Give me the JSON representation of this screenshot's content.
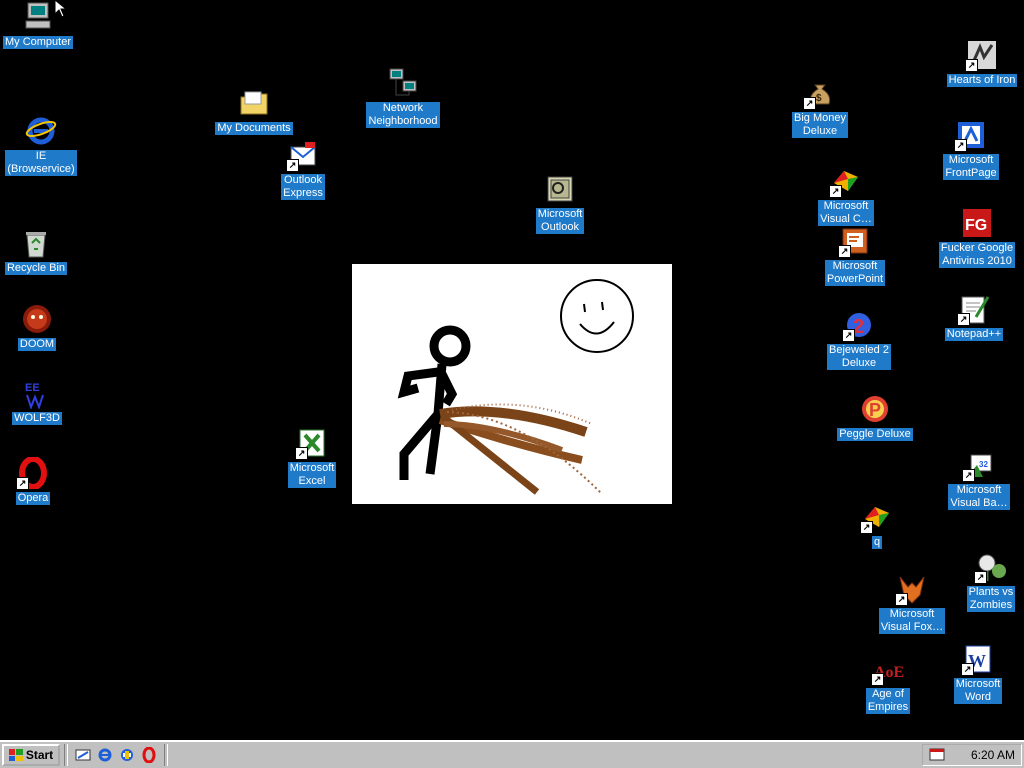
{
  "desktop": {
    "icons": {
      "my_computer": "My Computer",
      "ie": "IE\n(Browservice)",
      "recycle_bin": "Recycle Bin",
      "doom": "DOOM",
      "wolf3d": "WOLF3D",
      "opera": "Opera",
      "my_documents": "My Documents",
      "outlook_express": "Outlook\nExpress",
      "network_neighborhood": "Network\nNeighborhood",
      "microsoft_outlook": "Microsoft\nOutlook",
      "microsoft_excel": "Microsoft\nExcel",
      "big_money": "Big Money\nDeluxe",
      "visual_c": "Microsoft\nVisual C…",
      "powerpoint": "Microsoft\nPowerPoint",
      "bejeweled": "Bejeweled 2\nDeluxe",
      "peggle": "Peggle Deluxe",
      "q": "q",
      "visual_fox": "Microsoft\nVisual Fox…",
      "age_of_empires": "Age of\nEmpires",
      "hearts_of_iron": "Hearts of Iron",
      "frontpage": "Microsoft\nFrontPage",
      "antivirus": "Fucker Google\nAntivirus 2010",
      "notepadpp": "Notepad++",
      "visual_basic": "Microsoft\nVisual Ba…",
      "plants_vs_zombies": "Plants vs\nZombies",
      "word": "Microsoft\nWord"
    },
    "background_color": "#000000",
    "label_color": "#1f7ac9"
  },
  "taskbar": {
    "start_label": "Start",
    "clock": "6:20 AM"
  }
}
